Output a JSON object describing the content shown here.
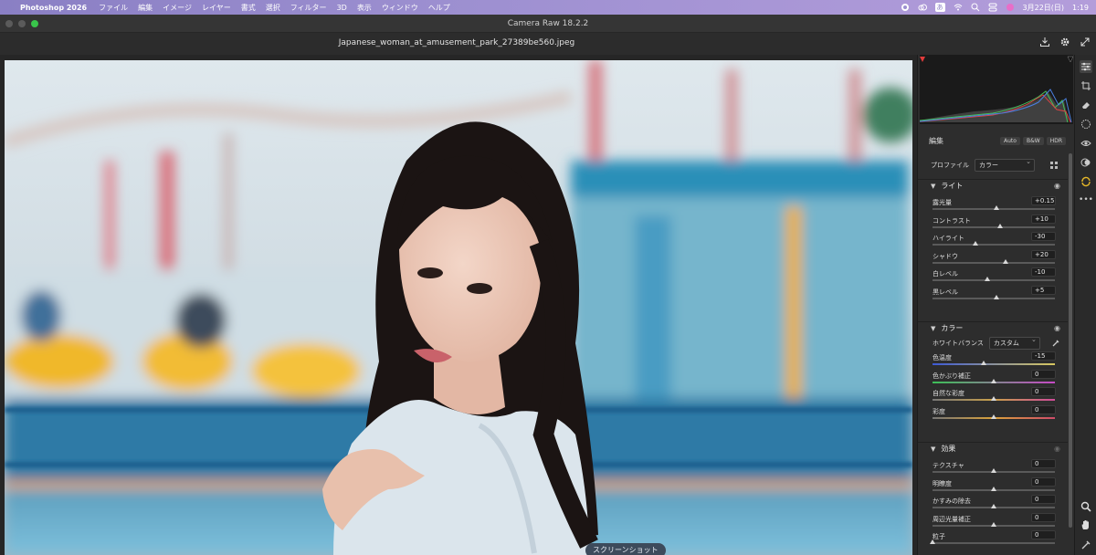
{
  "menubar": {
    "app_name": "Photoshop 2026",
    "items": [
      "ファイル",
      "編集",
      "イメージ",
      "レイヤー",
      "書式",
      "選択",
      "フィルター",
      "3D",
      "表示",
      "ウィンドウ",
      "ヘルプ"
    ],
    "date": "3月22日(日)",
    "time": "1:19",
    "input_source": "あ"
  },
  "window": {
    "title": "Camera Raw 18.2.2"
  },
  "file": {
    "name": "Japanese_woman_at_amusement_park_27389be560.jpeg"
  },
  "tooltip": "スクリーンショット",
  "panel": {
    "edit_tab": "編集",
    "modes": [
      "Auto",
      "B&W",
      "HDR"
    ],
    "profile_label": "プロファイル",
    "profile_value": "カラー",
    "light": {
      "title": "ライト",
      "sliders": [
        {
          "label": "露光量",
          "value": "+0.15",
          "pos": 0.52
        },
        {
          "label": "コントラスト",
          "value": "+10",
          "pos": 0.55
        },
        {
          "label": "ハイライト",
          "value": "-30",
          "pos": 0.35
        },
        {
          "label": "シャドウ",
          "value": "+20",
          "pos": 0.6
        },
        {
          "label": "白レベル",
          "value": "-10",
          "pos": 0.45
        },
        {
          "label": "黒レベル",
          "value": "+5",
          "pos": 0.52
        }
      ]
    },
    "color": {
      "title": "カラー",
      "wb_label": "ホワイトバランス",
      "wb_value": "カスタム",
      "sliders": [
        {
          "label": "色温度",
          "value": "-15",
          "pos": 0.42
        },
        {
          "label": "色かぶり補正",
          "value": "0",
          "pos": 0.5
        },
        {
          "label": "自然な彩度",
          "value": "0",
          "pos": 0.5
        },
        {
          "label": "彩度",
          "value": "0",
          "pos": 0.5
        }
      ]
    },
    "effects": {
      "title": "効果",
      "sliders": [
        {
          "label": "テクスチャ",
          "value": "0",
          "pos": 0.5
        },
        {
          "label": "明瞭度",
          "value": "0",
          "pos": 0.5
        },
        {
          "label": "かすみの除去",
          "value": "0",
          "pos": 0.5
        },
        {
          "label": "周辺光量補正",
          "value": "0",
          "pos": 0.5
        },
        {
          "label": "粒子",
          "value": "0",
          "pos": 0.0
        }
      ]
    }
  },
  "tools": [
    "edit-icon",
    "crop-icon",
    "eraser-icon",
    "mask-icon",
    "redeye-icon",
    "presets-icon",
    "sync-icon",
    "more-icon",
    "zoom-icon",
    "hand-icon",
    "eyedropper-icon"
  ]
}
